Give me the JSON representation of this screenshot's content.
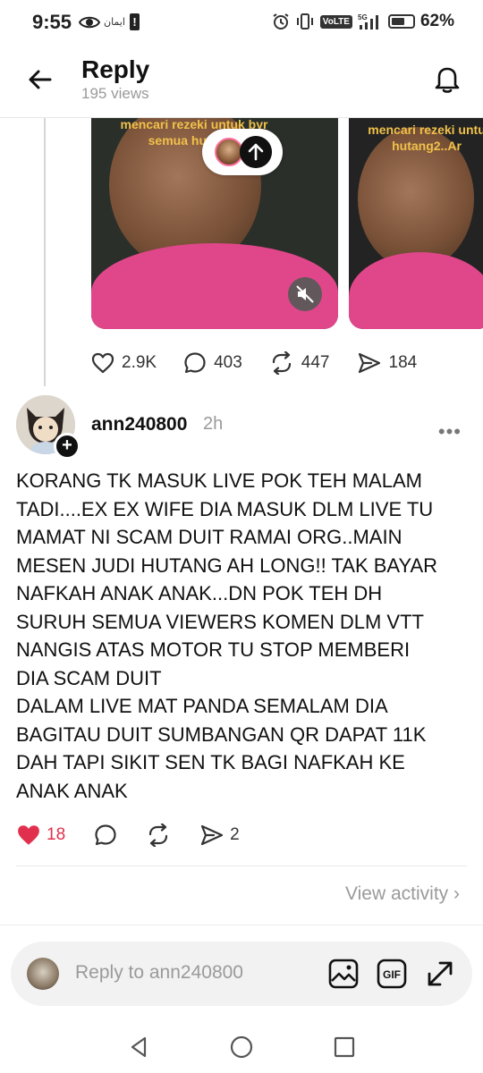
{
  "status_bar": {
    "time": "9:55",
    "carrier_label": "ايمان",
    "alert": "!",
    "network_badge": "VoLTE",
    "network_gen": "5G",
    "battery_percent": "62%",
    "battery_level": 0.62
  },
  "header": {
    "title": "Reply",
    "views": "195 views"
  },
  "parent_post": {
    "media": [
      {
        "caption": "mencari rezeki untuk byr semua hutang2"
      },
      {
        "caption": "mencari rezeki untu hutang2..Ar"
      }
    ],
    "stats": {
      "likes": "2.9K",
      "comments": "403",
      "reposts": "447",
      "shares": "184"
    }
  },
  "reply": {
    "username": "ann240800",
    "time": "2h",
    "body_lines": [
      "KORANG TK MASUK LIVE POK TEH MALAM",
      "TADI....EX EX WIFE DIA MASUK DLM LIVE TU",
      "MAMAT NI SCAM DUIT RAMAI ORG..MAIN",
      "MESEN JUDI HUTANG AH LONG!! TAK BAYAR",
      "NAFKAH ANAK ANAK...DN POK TEH DH",
      "SURUH SEMUA VIEWERS KOMEN DLM VTT",
      "NANGIS ATAS MOTOR TU STOP MEMBERI",
      "DIA SCAM DUIT",
      "DALAM LIVE MAT PANDA SEMALAM DIA",
      "BAGITAU DUIT SUMBANGAN QR DAPAT 11K",
      "DAH TAPI SIKIT SEN TK BAGI NAFKAH KE",
      "ANAK ANAK"
    ],
    "actions": {
      "likes": "18",
      "shares": "2"
    },
    "view_activity": "View activity"
  },
  "composer": {
    "placeholder": "Reply to ann240800",
    "gif_label": "GIF"
  },
  "colors": {
    "like_red": "#e0304d",
    "muted_gray": "#9a9a9a",
    "shirt_pink": "#e0478a",
    "caption_yellow": "#f1c14a"
  }
}
